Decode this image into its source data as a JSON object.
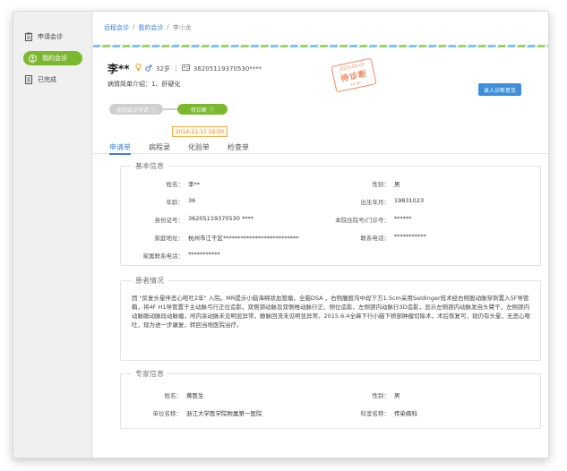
{
  "sidebar": {
    "items": [
      {
        "label": "申请会诊",
        "icon": "clipboard-icon",
        "active": false
      },
      {
        "label": "我的会诊",
        "icon": "user-icon",
        "active": true
      },
      {
        "label": "已完成",
        "icon": "checklist-icon",
        "active": false
      }
    ]
  },
  "breadcrumb": [
    "远程会诊",
    "我的会诊",
    "李小龙"
  ],
  "patient": {
    "name": "李**",
    "age": "32岁",
    "id_number": "36205119370530****",
    "diagnosis": "病情简单介绍：1、肝硬化"
  },
  "stamp": {
    "date": "2015-04-07",
    "text": "待诊断",
    "sub": "16:00"
  },
  "enter_button": "录入诊断意见",
  "progress": {
    "step1": "收到会诊申请",
    "step2": "待诊断",
    "date": "2014-11-17 16:00"
  },
  "tabs": [
    "申请单",
    "病程录",
    "化验单",
    "检查单"
  ],
  "basic_info": {
    "title": "基本信息",
    "left": [
      {
        "label": "姓名：",
        "value": "李**"
      },
      {
        "label": "年龄：",
        "value": "36"
      },
      {
        "label": "身份证号：",
        "value": "36205119370530 ****"
      },
      {
        "label": "家庭地址：",
        "value": "杭州市江干区**************************"
      },
      {
        "label": "家属联系电话：",
        "value": "***********"
      }
    ],
    "right": [
      {
        "label": "性别：",
        "value": "男"
      },
      {
        "label": "出生年月：",
        "value": "19831023"
      },
      {
        "label": "本院住院号/门诊号：",
        "value": "******"
      },
      {
        "label": "联系电话：",
        "value": "***********"
      }
    ]
  },
  "condition": {
    "title": "患者情况",
    "text": "因 \"反复头晕伴恶心呕吐2年\" 入院。MR提示小脑海绵状血管瘤，全脑DSA ，右侧腹股沟中段下方1.5cm采用Seldinger技术经右侧股动脉穿刺置入5F导管鞘，将4F H1导管置于主动脉弓行正位造影，双侧颈动脉及双侧椎动脉行正、侧位造影，左侧颈内动脉行3D造影，显示左侧颈内动脉发自头臂干，左侧颈内动脉眼动脉段动脉瘤，颅内余动脉未见明显异常，静脉回流未见明显异常。2015.6.4全麻下行小脑下桥部肿瘤切除术，术后恢复可，现仍有头晕，无恶心呕吐，现为进一步康复，转回当地医院治疗。"
  },
  "expert": {
    "title": "专家信息",
    "name_label": "姓名：",
    "name": "黄医生",
    "gender_label": "性别：",
    "gender": "男",
    "org_label": "单位名称：",
    "org": "浙江大学医学院附属第一医院",
    "dept_label": "科室名称：",
    "dept": "传染病科"
  }
}
